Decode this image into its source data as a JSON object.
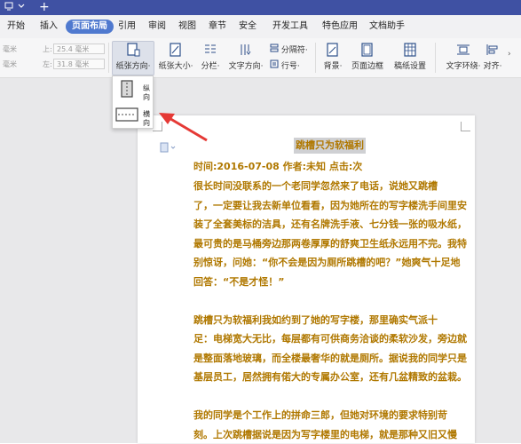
{
  "menu": {
    "tabs": [
      {
        "label": "开始"
      },
      {
        "label": "插入"
      },
      {
        "label": "页面布局"
      },
      {
        "label": "引用"
      },
      {
        "label": "审阅"
      },
      {
        "label": "视图"
      },
      {
        "label": "章节"
      },
      {
        "label": "安全"
      },
      {
        "label": "开发工具"
      },
      {
        "label": "特色应用"
      },
      {
        "label": "文档助手"
      }
    ],
    "active_index": 2
  },
  "ribbon": {
    "margin_unit_top": "毫米",
    "margin_unit_bottom": "毫米",
    "top_label": "上:",
    "top_value": "25.4 毫米",
    "left_label": "左:",
    "left_value": "31.8 毫米",
    "orientation_label": "纸张方向·",
    "size_label": "纸张大小·",
    "columns_label": "分栏·",
    "text_dir_label": "文字方向·",
    "break_label": "分隔符·",
    "line_num_label": "行号·",
    "background_label": "背景·",
    "border_label": "页面边框",
    "manuscript_label": "稿纸设置",
    "wrap_label": "文字环绕·",
    "align_label": "对齐·"
  },
  "dropdown": {
    "portrait_label": "纵向",
    "landscape_label": "横向"
  },
  "document": {
    "title": "跳槽只为软福利",
    "meta": "时间:2016-07-08  作者:未知  点击:次",
    "lines": [
      "      很长时间没联系的一个老同学忽然来了电话，说她又跳槽",
      "了，一定要让我去新单位看看，因为她所在的写字楼洗手间里安",
      "装了全套美标的洁具，还有名牌洗手液、七分钱一张的吸水纸，",
      "最可贵的是马桶旁边那两卷厚厚的舒爽卫生纸永远用不完。我特",
      "别惊讶，问她：“你不会是因为厕所跳槽的吧？”她爽气十足地",
      "回答：“不是才怪！”",
      "",
      "      跳槽只为软福利我如约到了她的写字楼，那里确实气派十",
      "足：电梯宽大无比，每层都有可供商务洽谈的柔软沙发，旁边就",
      "是整面落地玻璃，而全楼最奢华的就是厕所。据说我的同学只是",
      "基层员工，居然拥有偌大的专属办公室，还有几盆精致的盆栽。",
      "",
      "      我的同学是个工作上的拼命三郎，但她对环境的要求特别苛",
      "刻。上次跳槽据说是因为写字楼里的电梯，就是那种又旧又慢"
    ]
  },
  "colors": {
    "titlebar": "#3f51a3",
    "accent": "#4f79cf",
    "doc_text": "#b07800",
    "arrow": "#e53935"
  }
}
